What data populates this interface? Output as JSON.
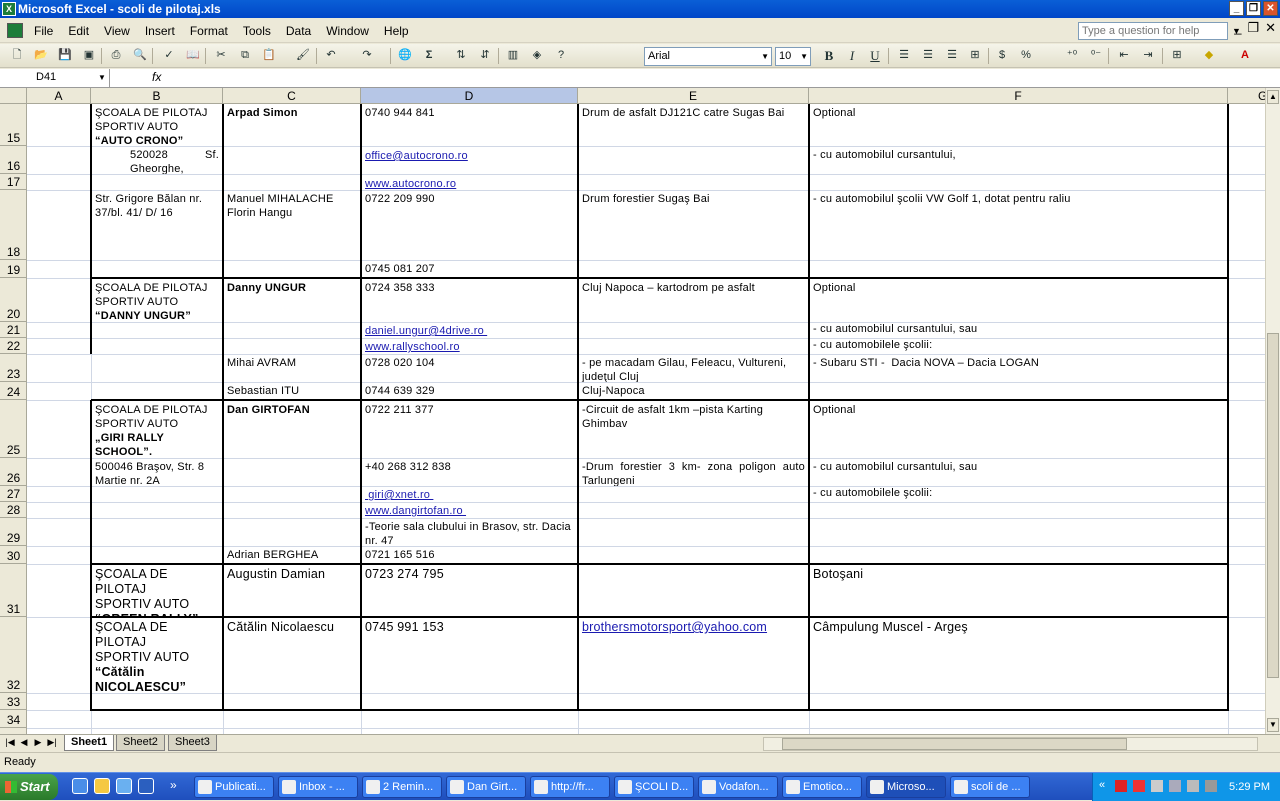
{
  "window": {
    "title": "Microsoft Excel - scoli de pilotaj.xls",
    "buttons": [
      "_",
      "❐",
      "✕"
    ]
  },
  "menu": {
    "items": [
      "File",
      "Edit",
      "View",
      "Insert",
      "Format",
      "Tools",
      "Data",
      "Window",
      "Help"
    ],
    "ask_placeholder": "Type a question for help",
    "close_buttons": [
      "_",
      "❐",
      "✕"
    ]
  },
  "toolbar": {
    "font": "Arial",
    "size": "10",
    "bold": "B",
    "italic": "I",
    "underline": "U",
    "currency": "$",
    "percent": "%",
    "autosum": "Σ"
  },
  "formula": {
    "name_box": "D41",
    "fx": "fx",
    "content": ""
  },
  "columns": [
    "A",
    "B",
    "C",
    "D",
    "E",
    "F",
    "G"
  ],
  "selected_column": "D",
  "rows": [
    "15",
    "16",
    "17",
    "18",
    "19",
    "20",
    "21",
    "22",
    "23",
    "24",
    "25",
    "26",
    "27",
    "28",
    "29",
    "30",
    "31",
    "32",
    "33",
    "34"
  ],
  "cells": {
    "b15": "ŞCOALA DE PILOTAJ\nSPORTIV AUTO\n“AUTO CRONO”",
    "c15": "Arpad Simon",
    "d15": "0740 944 841",
    "e15": "Drum de asfalt DJ121C catre Sugas Bai",
    "f15": "Optional",
    "b16": "520028 Sf. Gheorghe,",
    "d16": "office@autocrono.ro",
    "f16": "- cu automobilul cursantului,",
    "d17": "www.autocrono.ro",
    "b18": "Str. Grigore Bălan nr. 37/bl. 41/ D/ 16",
    "c18": "Manuel MIHALACHE\nFlorin Hangu",
    "d18": "0722 209 990",
    "e18": "Drum forestier Sugaş Bai",
    "f18": "- cu automobilul şcolii VW Golf 1, dotat pentru raliu",
    "d19": "0745 081 207",
    "b20": "ŞCOALA DE PILOTAJ\nSPORTIV AUTO\n“DANNY UNGUR”",
    "c20": "Danny UNGUR",
    "d20": "0724 358 333",
    "e20": "Cluj Napoca – kartodrom pe asfalt",
    "f20": "Optional",
    "d21": "daniel.ungur@4drive.ro ",
    "f21": "- cu automobilul cursantului, sau",
    "d22": "www.rallyschool.ro",
    "f22": "- cu automobilele şcolii:",
    "c23": "Mihai AVRAM",
    "d23": "0728 020 104",
    "e23": "- pe macadam Gilau, Feleacu, Vultureni, judeţul Cluj",
    "f23": "- Subaru STI -  Dacia NOVA – Dacia LOGAN",
    "c24": "Sebastian ITU",
    "d24": "0744 639 329",
    "e24": "Cluj-Napoca",
    "b25": "ŞCOALA DE PILOTAJ\nSPORTIV AUTO\n„GIRI RALLY\nSCHOOL”.",
    "c25": "Dan GIRTOFAN",
    "d25": "0722 211 377",
    "e25": "-Circuit de asfalt 1km –pista Karting Ghimbav",
    "f25": "Optional",
    "b26": "500046 Braşov, Str. 8 Martie nr. 2A",
    "d26": "+40 268 312 838",
    "e26": "-Drum forestier 3 km- zona poligon auto Tarlungeni",
    "f26": "- cu automobilul cursantului, sau",
    "d27": " giri@xnet.ro ",
    "f27": "- cu automobilele şcolii:",
    "d28": "www.dangirtofan.ro ",
    "d29": "-Teorie sala clubului in Brasov, str. Dacia nr. 47",
    "c30": "Adrian BERGHEA",
    "d30": "0721 165 516",
    "b31": "ŞCOALA DE PILOTAJ\nSPORTIV AUTO\n“GREEN RALLY”",
    "c31": "Augustin Damian",
    "d31": "0723 274 795",
    "f31": "Botoşani",
    "b32": "ŞCOALA DE PILOTAJ\nSPORTIV AUTO\n“Cătălin\nNICOLAESCU”",
    "c32": "Cătălin Nicolaescu",
    "d32": "0745 991 153",
    "e32": "brothersmotorsport@yahoo.com",
    "f32": "Câmpulung Muscel - Argeş"
  },
  "sheets": [
    "Sheet1",
    "Sheet2",
    "Sheet3"
  ],
  "active_sheet": "Sheet1",
  "status": "Ready",
  "taskbar": {
    "start": "Start",
    "tasks": [
      "Publicati...",
      "Inbox - ...",
      "2 Remin...",
      "Dan Girt...",
      "http://fr...",
      "ŞCOLI D...",
      "Vodafon...",
      "Emotico...",
      "Microso...",
      "scoli de ..."
    ],
    "active_task": "Microso...",
    "clock": "5:29 PM"
  }
}
